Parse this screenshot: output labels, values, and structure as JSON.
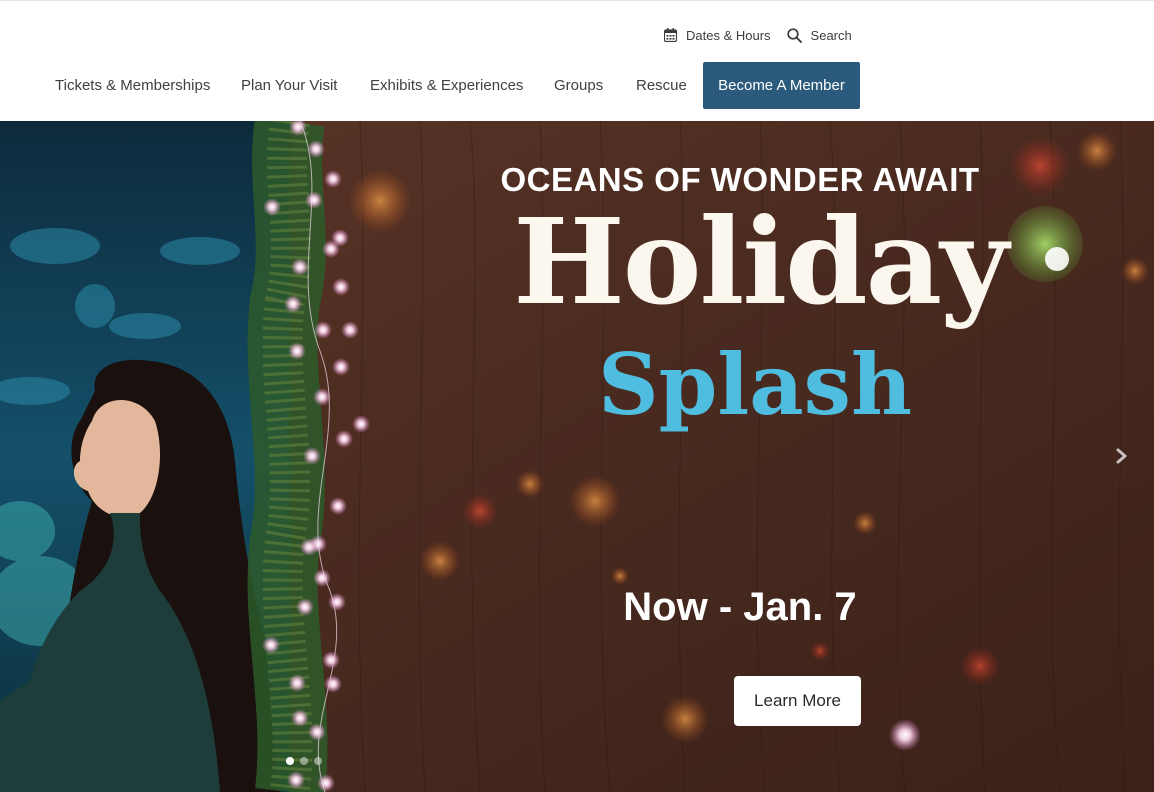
{
  "utility": {
    "dates_hours_label": "Dates & Hours",
    "search_label": "Search"
  },
  "nav": {
    "items": [
      {
        "label": "Tickets & Memberships"
      },
      {
        "label": "Plan Your Visit"
      },
      {
        "label": "Exhibits & Experiences"
      },
      {
        "label": "Groups"
      },
      {
        "label": "Rescue"
      }
    ],
    "cta_label": "Become A Member"
  },
  "hero": {
    "tagline": "OCEANS OF WONDER AWAIT",
    "title_line1": "Holiday",
    "title_line2": "Splash",
    "dates": "Now - Jan. 7",
    "button_label": "Learn More",
    "slide_count": 3,
    "active_slide": 1
  },
  "icons": {
    "calendar": "calendar-icon",
    "search": "search-icon",
    "next": "chevron-right-icon"
  },
  "colors": {
    "cta_bg": "#2b5a7c",
    "title_cream": "#fbf6ee",
    "title_blue": "#4fbde0",
    "wood": "#4a2c20"
  }
}
